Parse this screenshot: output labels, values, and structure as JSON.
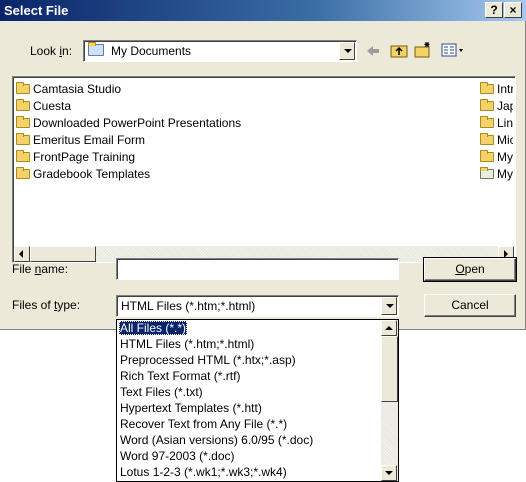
{
  "window": {
    "title": "Select File",
    "help_label": "?",
    "close_label": "×"
  },
  "lookin": {
    "label_pre": "Look ",
    "label_key": "i",
    "label_post": "n:",
    "value": "My Documents"
  },
  "toolbar": {
    "icons": [
      "back-arrow-icon",
      "up-folder-icon",
      "new-folder-icon",
      "view-menu-icon"
    ]
  },
  "files": {
    "left_column": [
      "Camtasia Studio",
      "Cuesta",
      "Downloaded PowerPoint Presentations",
      "Emeritus Email Form",
      "FrontPage Training",
      "Gradebook Templates"
    ],
    "right_column": [
      "Intro",
      "Japa",
      "Links",
      "Micro",
      "My A",
      "My D"
    ]
  },
  "filename": {
    "label_pre": "File ",
    "label_key": "n",
    "label_post": "ame:",
    "value": ""
  },
  "filetype": {
    "label_pre": "Files of ",
    "label_key": "t",
    "label_post": "ype:",
    "value": "HTML Files (*.htm;*.html)"
  },
  "buttons": {
    "open_key": "O",
    "open_rest": "pen",
    "cancel": "Cancel"
  },
  "filetype_options": [
    "All Files (*.*)",
    "HTML Files (*.htm;*.html)",
    "Preprocessed HTML (*.htx;*.asp)",
    "Rich Text Format (*.rtf)",
    "Text Files (*.txt)",
    "Hypertext Templates (*.htt)",
    "Recover Text from Any File (*.*)",
    "Word (Asian versions) 6.0/95 (*.doc)",
    "Word 97-2003 (*.doc)",
    "Lotus 1-2-3 (*.wk1;*.wk3;*.wk4)"
  ],
  "colors": {
    "title_bar": "#0a246a",
    "dialog_bg": "#ece9d8",
    "selection": "#0a246a",
    "folder": "#f4d26a"
  }
}
